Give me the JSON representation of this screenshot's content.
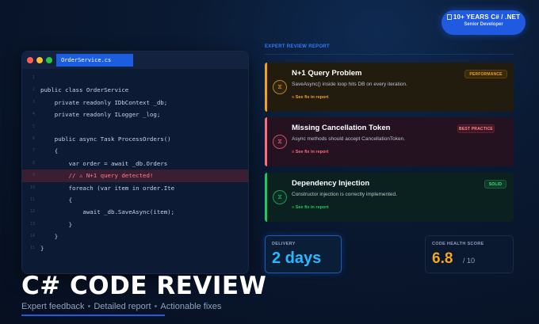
{
  "badge": {
    "line1": "10+ YEARS C# / .NET",
    "line2": "Senior Developer"
  },
  "editor": {
    "filename": "OrderService.cs",
    "lines": [
      {
        "num": "1",
        "code": ""
      },
      {
        "num": "2",
        "code": "public class OrderService"
      },
      {
        "num": "3",
        "code": "    private readonly IDbContext _db;"
      },
      {
        "num": "4",
        "code": "    private readonly ILogger _log;"
      },
      {
        "num": "5",
        "code": ""
      },
      {
        "num": "6",
        "code": "    public async Task ProcessOrders()"
      },
      {
        "num": "7",
        "code": "    {"
      },
      {
        "num": "8",
        "code": "        var order = await _db.Orders"
      },
      {
        "num": "9",
        "code": "        // ⚠ N+1 query detected!"
      },
      {
        "num": "10",
        "code": "        foreach (var item in order.Ite"
      },
      {
        "num": "11",
        "code": "        {"
      },
      {
        "num": "12",
        "code": "            await _db.SaveAsync(item);"
      },
      {
        "num": "13",
        "code": "        }"
      },
      {
        "num": "14",
        "code": "    }"
      },
      {
        "num": "15",
        "code": "}"
      }
    ]
  },
  "title": "C# CODE REVIEW",
  "subtitle": {
    "part1": "Expert feedback",
    "part2": "Detailed report",
    "part3": "Actionable fixes",
    "separator": "•"
  },
  "review": {
    "section_label": "EXPERT REVIEW REPORT",
    "cards": [
      {
        "title": "N+1 Query Problem",
        "desc": "SaveAsync() inside loop hits DB on every iteration.",
        "link": "See fix in report",
        "tag": "PERFORMANCE",
        "icon": "⧖"
      },
      {
        "title": "Missing Cancellation Token",
        "desc": "Async methods should accept CancellationToken.",
        "link": "See fix in report",
        "tag": "BEST PRACTICE",
        "icon": "⧖"
      },
      {
        "title": "Dependency Injection",
        "desc": "Constructor injection is correctly implemented.",
        "link": "See fix in report",
        "tag": "SOLID",
        "icon": "⧖"
      }
    ]
  },
  "stats": {
    "delivery_label": "DELIVERY",
    "delivery_value": "2 days",
    "health_label": "CODE HEALTH SCORE",
    "health_value": "6.8",
    "health_suffix": "/ 10"
  },
  "colors": {
    "accent": "#1f5ae0",
    "performance": "#f0a21a",
    "best_practice": "#ff6a7d",
    "solid": "#22c55e",
    "delivery": "#29b8ff",
    "score": "#f5a623"
  }
}
